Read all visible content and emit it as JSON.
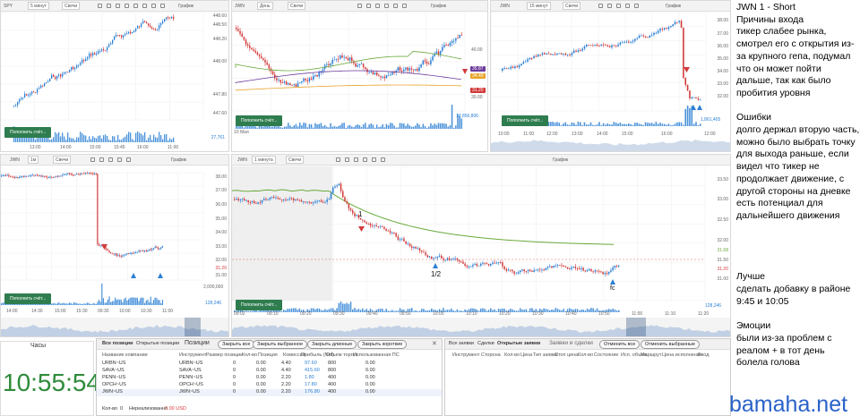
{
  "colors": {
    "up": "#2a7fd4",
    "down": "#d23a3a",
    "clock": "#2e8b3a",
    "button": "#2f7d4f",
    "watermark": "#2a62c9",
    "ma_green": "#6aaa3b",
    "ma_purple": "#6a3a9a",
    "ma_orange": "#e8a42b"
  },
  "panels": {
    "spy": {
      "ticker": "SPY",
      "timeframe": "5 минут",
      "type": "Свечи",
      "label": "График",
      "yticks": [
        "448.60",
        "448.50",
        "448.20",
        "448.00",
        "447.80",
        "447.60"
      ],
      "xticks": [
        "13:00",
        "14:00",
        "15:00",
        "15:45",
        "16:00",
        "11:00"
      ],
      "volume": "27,761",
      "button": "Пополнить счёт..."
    },
    "jwn_day": {
      "ticker": "JWN",
      "timeframe": "День",
      "type": "Свечи",
      "label": "График",
      "yticks": [
        "40.00",
        "35.87",
        "34.49",
        "31.20",
        "30.00"
      ],
      "xticks": [
        "10 Мая"
      ],
      "volume": "17,856,806",
      "button": "Пополнить счёт..."
    },
    "jwn_15m": {
      "ticker": "JWN",
      "timeframe": "15 минут",
      "type": "Свечи",
      "label": "График",
      "yticks": [
        "38.00",
        "37.00",
        "36.00",
        "35.00",
        "34.00",
        "33.00",
        "32.00",
        "31.00"
      ],
      "xticks": [
        "10:00",
        "11:00",
        "12:00",
        "13:00",
        "14:00",
        "15:00",
        "16:00",
        "12:00"
      ],
      "volume": "1,861,405",
      "button": "Пополнить счёт..."
    },
    "jwn_1m_small": {
      "ticker": "JWN",
      "timeframe": "1м",
      "type": "Свечи",
      "label": "График",
      "yticks": [
        "38.00",
        "37.00",
        "36.00",
        "35.00",
        "34.00",
        "33.00",
        "32.00",
        "31.20",
        "31.00"
      ],
      "xticks": [
        "14:00",
        "14:30",
        "15:00",
        "15:30",
        "09:30",
        "10:00",
        "10:30",
        "11:00"
      ],
      "volume_max": "2,000,000",
      "volume": "128,246",
      "button": "Пополнить счёт..."
    },
    "jwn_1m_main": {
      "ticker": "JWN",
      "timeframe": "1 минута",
      "type": "Свечи",
      "label": "График",
      "yticks": [
        "33.50",
        "33.00",
        "32.50",
        "32.00",
        "31.68",
        "31.50",
        "31.20",
        "31.00"
      ],
      "xticks": [
        "09:02",
        "09:10",
        "09:20",
        "09:30",
        "09:40",
        "09:50",
        "10:00",
        "10:10",
        "10:20",
        "10:30",
        "10:40",
        "10:50",
        "11:00",
        "11:10",
        "11:20"
      ],
      "volume": "128,246",
      "button": "Пополнить счёт...",
      "marker_entry": "1",
      "marker_half": "1/2",
      "marker_fc": "fc"
    }
  },
  "clock": {
    "title": "Часы",
    "time": "10:55:54"
  },
  "positions": {
    "tabs": [
      "Все позиции",
      "Открытые позиции",
      "Позиции"
    ],
    "buttons": [
      "Закрыть все",
      "Закрыть выбранное",
      "Закрыть длинные",
      "Закрыть короткие"
    ],
    "headers": [
      "Название компании",
      "Инструмент",
      "Размер позиции",
      "Кол-во",
      "Позиция",
      "Комиссии",
      "Прибыль (Net)",
      "Объем торгов",
      "Использованная ПС"
    ],
    "rows": [
      [
        "URBN~US",
        "URBN~US",
        "0",
        "0.00",
        "4.40",
        "97.60",
        "800",
        "0.00"
      ],
      [
        "SAVA~US",
        "SAVA~US",
        "0",
        "0.00",
        "4.40",
        "415.60",
        "800",
        "0.00"
      ],
      [
        "PENN~US",
        "PENN~US",
        "0",
        "0.00",
        "2.20",
        "1.80",
        "400",
        "0.00"
      ],
      [
        "OPCH~US",
        "OPCH~US",
        "0",
        "0.00",
        "2.20",
        "17.80",
        "400",
        "0.00"
      ],
      [
        "JWN~US",
        "JWN~US",
        "0",
        "0.00",
        "2.20",
        "176.80",
        "400",
        "0.00"
      ]
    ],
    "footer_count_label": "Кол-во",
    "footer_count": "0",
    "footer_unrealized_label": "Нереализованно",
    "footer_unrealized": "0.00 USD"
  },
  "orders": {
    "tabs": [
      "Все заявки",
      "Сделки",
      "Открытые заявки",
      "Заявки и сделки"
    ],
    "buttons": [
      "Отменить все",
      "Отменить выбранные"
    ],
    "headers": [
      "Инструмент",
      "Сторона",
      "Кол-во",
      "Цена",
      "Тип заявки",
      "Стоп цена",
      "Кол-во",
      "Состояние",
      "Исп. объем",
      "Маршрут",
      "Цена исполнения",
      "Вход"
    ]
  },
  "notes": {
    "lines": [
      "JWN 1 - Short",
      "Причины входа",
      "тикер слабее рынка,",
      "смотрел его с открытия из-",
      "за крупного гепа, подумал",
      "что он может пойти",
      "дальше, так как было",
      "пробития уровня",
      "",
      "Ошибки",
      "долго держал вторую часть,",
      "можно было выбрать точку",
      "для выхода раньше, если",
      "видел что тикер не",
      "продолжает движение, с",
      "другой стороны на дневке",
      "есть потенциал для",
      "дальнейшего движения",
      "",
      "",
      "",
      "",
      "Лучше",
      "сделать добавку в районе",
      "9:45 и 10:05",
      "",
      "Эмоции",
      "были из-за проблем с",
      "реалом + в тот день",
      "болела голова"
    ]
  },
  "watermark": "bamaha.net"
}
